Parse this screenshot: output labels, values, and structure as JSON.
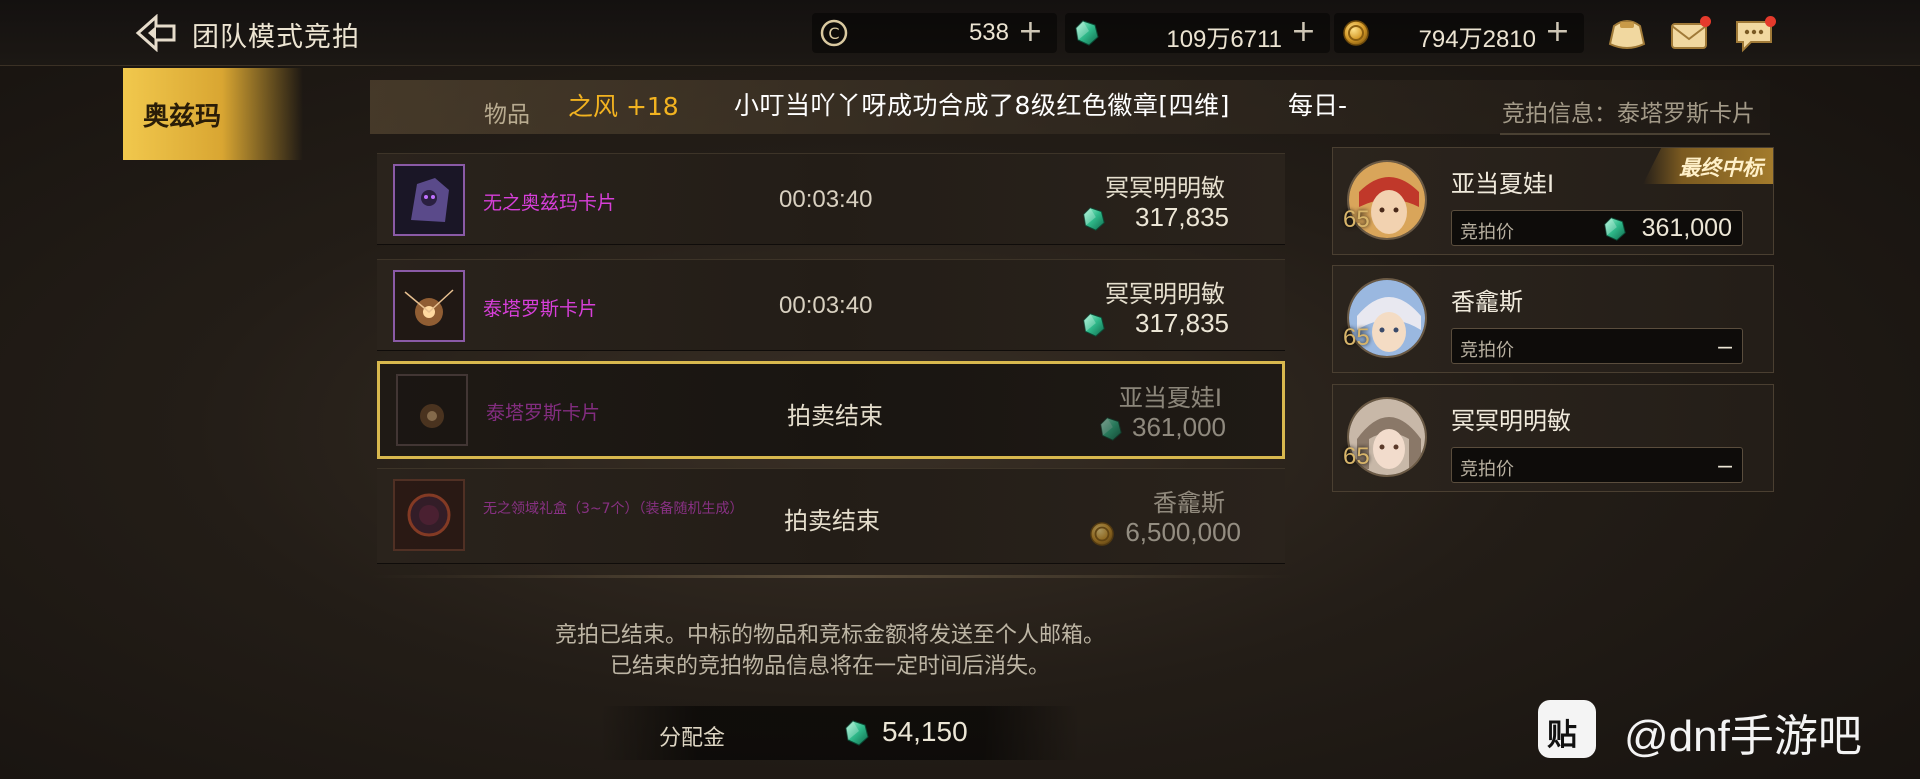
{
  "header": {
    "title": "团队模式竞拍",
    "currencies": [
      {
        "icon": "coin-c-icon",
        "value": "538"
      },
      {
        "icon": "green-gem-icon",
        "value": "109万6711"
      },
      {
        "icon": "gold-coin-icon",
        "value": "794万2810"
      }
    ],
    "plus": "+"
  },
  "left_tab": {
    "label": "奥兹玛"
  },
  "list_header": {
    "item_label": "物品",
    "ticker_part1": "之风 +18",
    "ticker_part2": "小叮当吖丫呀成功合成了8级红色徽章[四维]",
    "ticker_part3": "每日-",
    "info_label": "竞拍信息：泰塔罗斯卡片"
  },
  "rows": [
    {
      "name": "无之奥兹玛卡片",
      "timer": "00:03:40",
      "bidder": "冥冥明明敏",
      "price": "317,835",
      "currency": "green-gem"
    },
    {
      "name": "泰塔罗斯卡片",
      "timer": "00:03:40",
      "bidder": "冥冥明明敏",
      "price": "317,835",
      "currency": "green-gem"
    },
    {
      "name": "泰塔罗斯卡片",
      "state": "拍卖结束",
      "bidder": "亚当夏娃I",
      "price": "361,000",
      "currency": "green-gem"
    },
    {
      "name": "无之领域礼盒（3~7个）（装备随机生成）",
      "state": "拍卖结束",
      "bidder": "香龕斯",
      "price": "6,500,000",
      "currency": "gold-coin"
    }
  ],
  "notice": {
    "line1": "竞拍已结束。中标的物品和竞标金额将发送至个人邮箱。",
    "line2": "已结束的竞拍物品信息将在一定时间后消失。"
  },
  "allocation": {
    "label": "分配金",
    "value": "54,150"
  },
  "bidders": [
    {
      "name": "亚当夏娃I",
      "level": "65",
      "bid_label": "竞拍价",
      "bid_value": "361,000",
      "badge": "最终中标"
    },
    {
      "name": "香龕斯",
      "level": "65",
      "bid_label": "竞拍价",
      "bid_value": "–"
    },
    {
      "name": "冥冥明明敏",
      "level": "65",
      "bid_label": "竞拍价",
      "bid_value": "–"
    }
  ],
  "watermark": {
    "icon_text": "贴",
    "text": "@dnf手游吧"
  },
  "colors": {
    "accent_gold": "#d8b84e",
    "item_purple": "#d73fd9",
    "gem_green": "#3fd8a0",
    "coin_gold": "#d9a632"
  }
}
